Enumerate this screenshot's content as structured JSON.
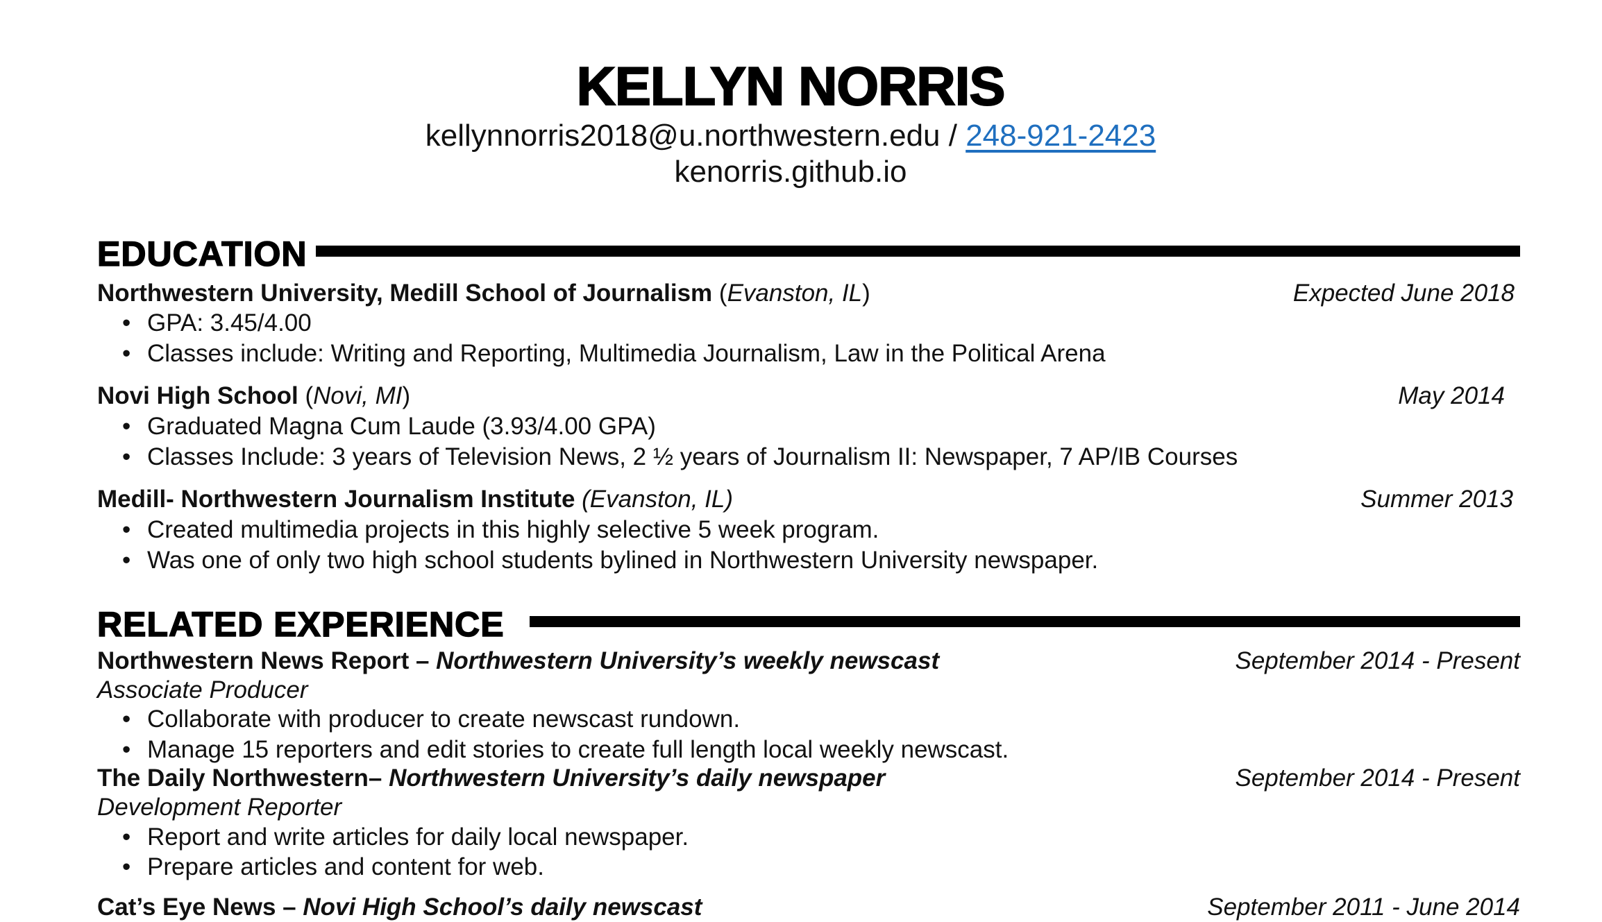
{
  "header": {
    "name": "KELLYN NORRIS",
    "email": "kellynnorris2018@u.northwestern.edu",
    "separator": " / ",
    "phone": "248-921-2423",
    "website": "kenorris.github.io"
  },
  "education": {
    "title": "EDUCATION",
    "entries": [
      {
        "school": "Northwestern University, Medill School of Journalism",
        "location_open": " (",
        "location": "Evanston, IL",
        "location_close": ")",
        "date": "Expected June 2018",
        "bullets": [
          "GPA: 3.45/4.00",
          "Classes include: Writing and Reporting, Multimedia Journalism, Law in the Political Arena"
        ]
      },
      {
        "school": "Novi High School",
        "location_open": " (",
        "location": "Novi, MI",
        "location_close": ")",
        "date": "May 2014",
        "bullets": [
          "Graduated Magna Cum Laude (3.93/4.00 GPA)",
          "Classes Include: 3 years of Television News, 2 ½ years of Journalism II: Newspaper, 7 AP/IB Courses"
        ]
      },
      {
        "school": "Medill- Northwestern Journalism Institute",
        "location_full": " (Evanston, IL)",
        "date": "Summer 2013",
        "bullets": [
          "Created multimedia projects in this highly selective 5 week program.",
          "Was one of only two high school students bylined in Northwestern University newspaper."
        ]
      }
    ]
  },
  "experience": {
    "title": "RELATED EXPERIENCE",
    "entries": [
      {
        "org": "Northwestern News Report – ",
        "desc": "Northwestern University’s weekly newscast",
        "date": "September 2014 - Present",
        "role": "Associate Producer",
        "bullets": [
          "Collaborate with producer to create newscast rundown.",
          "Manage 15 reporters and edit stories to create full length local weekly newscast."
        ]
      },
      {
        "org": "The Daily Northwestern– ",
        "desc": "Northwestern University’s daily newspaper",
        "date": "September 2014 - Present",
        "role": "Development Reporter",
        "bullets": [
          "Report and write articles for daily local newspaper.",
          "Prepare articles and content for web."
        ]
      },
      {
        "org": "Cat’s Eye News – ",
        "desc": "Novi High School’s daily newscast",
        "date": "September 2011 - June 2014"
      }
    ]
  },
  "bullet_glyph": "•"
}
